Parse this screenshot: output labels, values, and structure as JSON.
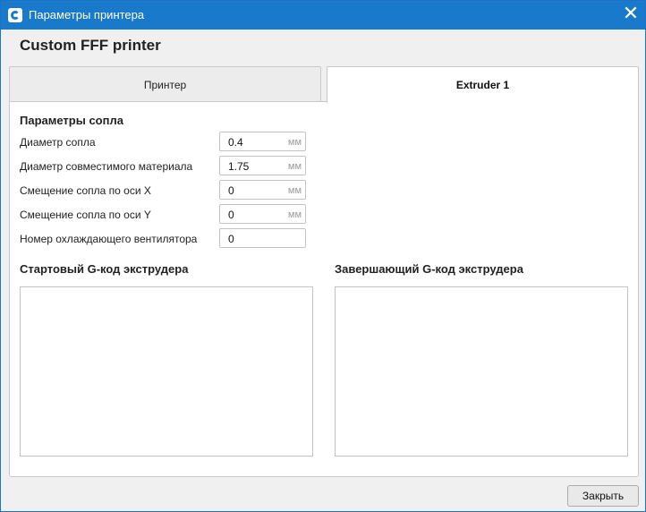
{
  "window": {
    "title": "Параметры принтера",
    "close_glyph": "✕"
  },
  "printer_name": "Custom FFF printer",
  "tabs": [
    {
      "label": "Принтер",
      "active": false
    },
    {
      "label": "Extruder 1",
      "active": true
    }
  ],
  "nozzle_settings": {
    "title": "Параметры сопла",
    "rows": [
      {
        "label": "Диаметр сопла",
        "value": "0.4",
        "unit": "мм"
      },
      {
        "label": "Диаметр совместимого материала",
        "value": "1.75",
        "unit": "мм"
      },
      {
        "label": "Смещение сопла по оси X",
        "value": "0",
        "unit": "мм"
      },
      {
        "label": "Смещение сопла по оси Y",
        "value": "0",
        "unit": "мм"
      },
      {
        "label": "Номер охлаждающего вентилятора",
        "value": "0",
        "unit": ""
      }
    ]
  },
  "gcode": {
    "start_title": "Стартовый G-код экструдера",
    "start_value": "",
    "end_title": "Завершающий G-код экструдера",
    "end_value": ""
  },
  "footer": {
    "close_label": "Закрыть"
  },
  "colors": {
    "titlebar": "#1979ca"
  },
  "icons": {
    "app": "cura-logo-icon",
    "close": "close-icon"
  }
}
